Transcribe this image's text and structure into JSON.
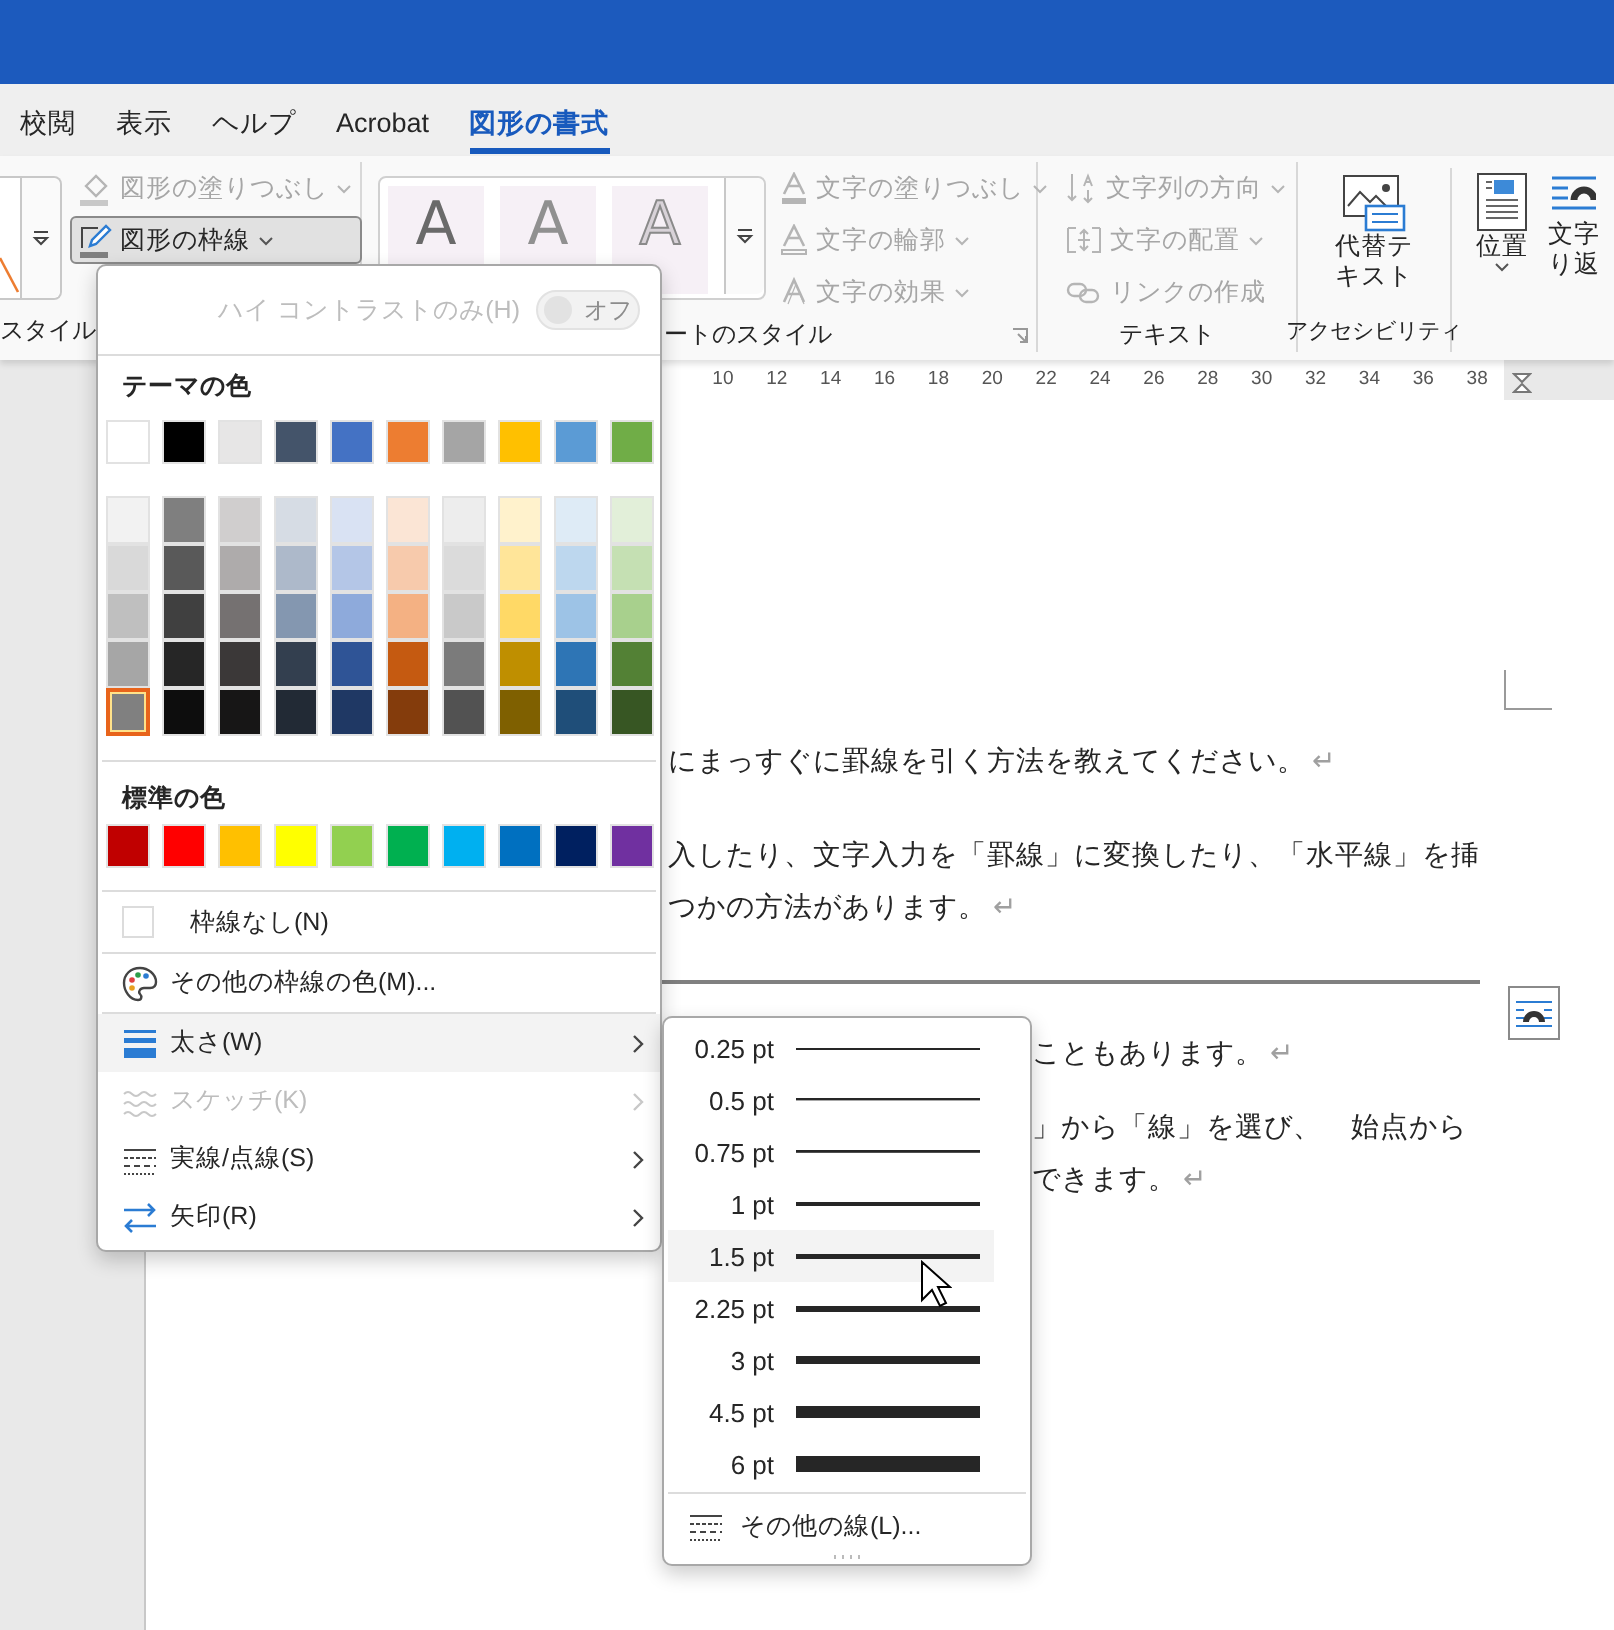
{
  "tabs": [
    {
      "label": "校閲",
      "selected": false
    },
    {
      "label": "表示",
      "selected": false
    },
    {
      "label": "ヘルプ",
      "selected": false
    },
    {
      "label": "Acrobat",
      "selected": false
    },
    {
      "label": "図形の書式",
      "selected": true
    }
  ],
  "ribbon": {
    "shape_styles": {
      "label": "スタイル",
      "fill_button": {
        "label": "図形の塗りつぶし",
        "disabled": true
      },
      "outline_button": {
        "label": "図形の枠線",
        "pressed": true
      }
    },
    "wordart_styles": {
      "label": "ートのスタイル",
      "gallery": [
        {
          "glyph": "A",
          "kind": "solid"
        },
        {
          "glyph": "A",
          "kind": "soft"
        },
        {
          "glyph": "A",
          "kind": "outline"
        }
      ],
      "buttons": [
        {
          "label": "文字の塗りつぶし",
          "kind": "fill",
          "disabled": true
        },
        {
          "label": "文字の輪郭",
          "kind": "outline",
          "disabled": true
        },
        {
          "label": "文字の効果",
          "kind": "effects",
          "disabled": true
        }
      ]
    },
    "text": {
      "label": "テキスト",
      "buttons": [
        {
          "label": "文字列の方向",
          "kind": "direction",
          "disabled": true,
          "dropdown": true
        },
        {
          "label": "文字の配置",
          "kind": "align",
          "disabled": true,
          "dropdown": true
        },
        {
          "label": "リンクの作成",
          "kind": "link",
          "disabled": true,
          "dropdown": false
        }
      ]
    },
    "accessibility": {
      "label": "アクセシビリティ",
      "button": {
        "label_lines": [
          "代替テ",
          "キスト"
        ]
      }
    },
    "arrange": {
      "buttons": [
        {
          "kind": "position",
          "label_lines": [
            "位置"
          ],
          "dropdown": true
        },
        {
          "kind": "wrap",
          "label_lines": [
            "文字",
            "り返"
          ],
          "dropdown": false
        }
      ]
    }
  },
  "ruler": {
    "ticks": [
      "10",
      "12",
      "14",
      "16",
      "18",
      "20",
      "22",
      "24",
      "26",
      "28",
      "30",
      "32",
      "34",
      "36",
      "38"
    ]
  },
  "document": {
    "lines_top": [
      {
        "text": "にまっすぐに罫線を引く方法を教えてください。",
        "mark": "↵"
      },
      {
        "text": "入したり、文字入力を「罫線」に変換したり、「水平線」を挿"
      },
      {
        "text": "つかの方法があります。",
        "mark": "↵"
      }
    ],
    "lines_bottom": [
      {
        "text": "こともあります。",
        "mark": "↵"
      },
      {
        "text": "」から「線」を選び、　始点から"
      },
      {
        "text": "できます。",
        "mark": "↵"
      }
    ]
  },
  "outline_menu": {
    "high_contrast": {
      "label": "ハイ コントラストのみ(H)",
      "toggle_label": "オフ",
      "on": false,
      "disabled": true
    },
    "theme_title": "テーマの色",
    "theme_colors": [
      {
        "color": "#ffffff",
        "selected": false
      },
      {
        "color": "#000000",
        "selected": false
      },
      {
        "color": "#e7e6e6",
        "selected": false
      },
      {
        "color": "#44546a",
        "selected": false
      },
      {
        "color": "#4472c4",
        "selected": false
      },
      {
        "color": "#ed7d31",
        "selected": false
      },
      {
        "color": "#a5a5a5",
        "selected": false
      },
      {
        "color": "#ffc000",
        "selected": false
      },
      {
        "color": "#5b9bd5",
        "selected": false
      },
      {
        "color": "#70ad47",
        "selected": false
      }
    ],
    "shade_columns": [
      {
        "swatches": [
          {
            "color": "#f2f2f2",
            "selected": false
          },
          {
            "color": "#d9d9d9",
            "selected": false
          },
          {
            "color": "#bfbfbf",
            "selected": false
          },
          {
            "color": "#a6a6a6",
            "selected": false
          },
          {
            "color": "#808080",
            "selected": true
          }
        ]
      },
      {
        "swatches": [
          {
            "color": "#7f7f7f",
            "selected": false
          },
          {
            "color": "#595959",
            "selected": false
          },
          {
            "color": "#404040",
            "selected": false
          },
          {
            "color": "#262626",
            "selected": false
          },
          {
            "color": "#0d0d0d",
            "selected": false
          }
        ]
      },
      {
        "swatches": [
          {
            "color": "#d0cece",
            "selected": false
          },
          {
            "color": "#aeabab",
            "selected": false
          },
          {
            "color": "#757171",
            "selected": false
          },
          {
            "color": "#3b3838",
            "selected": false
          },
          {
            "color": "#171616",
            "selected": false
          }
        ]
      },
      {
        "swatches": [
          {
            "color": "#d6dce4",
            "selected": false
          },
          {
            "color": "#adb9ca",
            "selected": false
          },
          {
            "color": "#8497b0",
            "selected": false
          },
          {
            "color": "#333f4f",
            "selected": false
          },
          {
            "color": "#222a35",
            "selected": false
          }
        ]
      },
      {
        "swatches": [
          {
            "color": "#d9e2f3",
            "selected": false
          },
          {
            "color": "#b4c6e7",
            "selected": false
          },
          {
            "color": "#8eaadb",
            "selected": false
          },
          {
            "color": "#2f5496",
            "selected": false
          },
          {
            "color": "#1f3864",
            "selected": false
          }
        ]
      },
      {
        "swatches": [
          {
            "color": "#fbe5d5",
            "selected": false
          },
          {
            "color": "#f7caac",
            "selected": false
          },
          {
            "color": "#f4b183",
            "selected": false
          },
          {
            "color": "#c55a11",
            "selected": false
          },
          {
            "color": "#843c0c",
            "selected": false
          }
        ]
      },
      {
        "swatches": [
          {
            "color": "#ededed",
            "selected": false
          },
          {
            "color": "#dbdbdb",
            "selected": false
          },
          {
            "color": "#c9c9c9",
            "selected": false
          },
          {
            "color": "#7b7b7b",
            "selected": false
          },
          {
            "color": "#525252",
            "selected": false
          }
        ]
      },
      {
        "swatches": [
          {
            "color": "#fff2cc",
            "selected": false
          },
          {
            "color": "#ffe599",
            "selected": false
          },
          {
            "color": "#ffd966",
            "selected": false
          },
          {
            "color": "#bf8f00",
            "selected": false
          },
          {
            "color": "#7f6000",
            "selected": false
          }
        ]
      },
      {
        "swatches": [
          {
            "color": "#deebf6",
            "selected": false
          },
          {
            "color": "#bdd7ee",
            "selected": false
          },
          {
            "color": "#9dc3e6",
            "selected": false
          },
          {
            "color": "#2e75b5",
            "selected": false
          },
          {
            "color": "#1f4e79",
            "selected": false
          }
        ]
      },
      {
        "swatches": [
          {
            "color": "#e2efd9",
            "selected": false
          },
          {
            "color": "#c5e0b3",
            "selected": false
          },
          {
            "color": "#a8d08d",
            "selected": false
          },
          {
            "color": "#538135",
            "selected": false
          },
          {
            "color": "#375623",
            "selected": false
          }
        ]
      }
    ],
    "standard_title": "標準の色",
    "standard_colors": [
      {
        "color": "#c00000",
        "selected": false
      },
      {
        "color": "#ff0000",
        "selected": false
      },
      {
        "color": "#ffc000",
        "selected": false
      },
      {
        "color": "#ffff00",
        "selected": false
      },
      {
        "color": "#92d050",
        "selected": false
      },
      {
        "color": "#00b050",
        "selected": false
      },
      {
        "color": "#00b0f0",
        "selected": false
      },
      {
        "color": "#0070c0",
        "selected": false
      },
      {
        "color": "#002060",
        "selected": false
      },
      {
        "color": "#7030a0",
        "selected": false
      }
    ],
    "items": [
      {
        "kind": "no-outline",
        "label": "枠線なし(N)",
        "has_submenu": false,
        "highlighted": false,
        "disabled": false
      },
      {
        "kind": "more-colors",
        "label": "その他の枠線の色(M)...",
        "has_submenu": false,
        "highlighted": false,
        "disabled": false
      },
      {
        "kind": "weight",
        "label": "太さ(W)",
        "has_submenu": true,
        "highlighted": true,
        "disabled": false
      },
      {
        "kind": "sketch",
        "label": "スケッチ(K)",
        "has_submenu": true,
        "highlighted": false,
        "disabled": true
      },
      {
        "kind": "dashes",
        "label": "実線/点線(S)",
        "has_submenu": true,
        "highlighted": false,
        "disabled": false
      },
      {
        "kind": "arrows",
        "label": "矢印(R)",
        "has_submenu": true,
        "highlighted": false,
        "disabled": false
      }
    ]
  },
  "weight_menu": {
    "items": [
      {
        "label": "0.25 pt",
        "kind": "w025",
        "highlighted": false
      },
      {
        "label": "0.5 pt",
        "kind": "w05",
        "highlighted": false
      },
      {
        "label": "0.75 pt",
        "kind": "w075",
        "highlighted": false
      },
      {
        "label": "1 pt",
        "kind": "w1",
        "highlighted": false
      },
      {
        "label": "1.5 pt",
        "kind": "w15",
        "highlighted": true
      },
      {
        "label": "2.25 pt",
        "kind": "w225",
        "highlighted": false
      },
      {
        "label": "3 pt",
        "kind": "w3",
        "highlighted": false
      },
      {
        "label": "4.5 pt",
        "kind": "w45",
        "highlighted": false
      },
      {
        "label": "6 pt",
        "kind": "w6",
        "highlighted": false
      }
    ],
    "more": {
      "label": "その他の線(L)..."
    }
  }
}
